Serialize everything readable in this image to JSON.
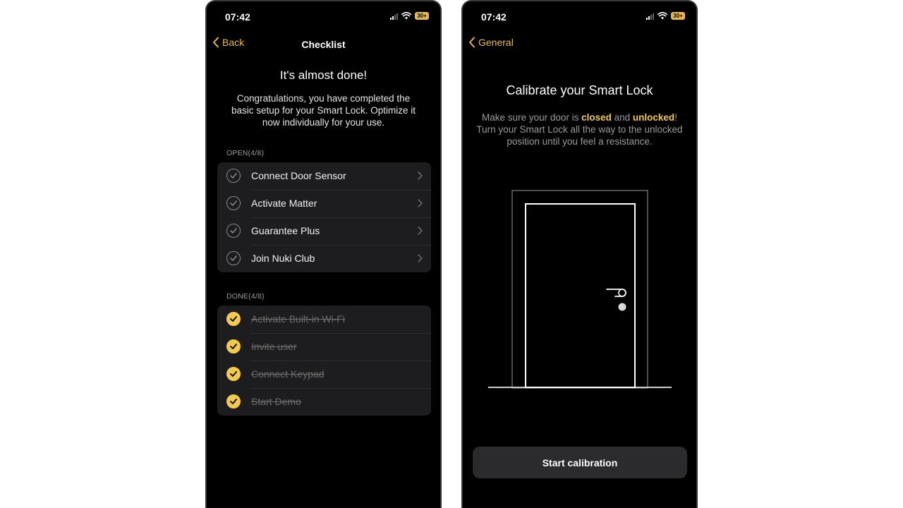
{
  "left_screen": {
    "status": {
      "time": "07:42",
      "battery": "30+"
    },
    "nav": {
      "back_label": "Back",
      "title": "Checklist"
    },
    "heading": "It's almost done!",
    "intro": "Congratulations, you have completed the basic setup for your Smart Lock. Optimize it now individually for your use.",
    "open_section": {
      "label": "OPEN(4/8)",
      "items": [
        {
          "label": "Connect Door Sensor"
        },
        {
          "label": "Activate Matter"
        },
        {
          "label": "Guarantee Plus"
        },
        {
          "label": "Join Nuki Club"
        }
      ]
    },
    "done_section": {
      "label": "DONE(4/8)",
      "items": [
        {
          "label": "Activate Built-in Wi-Fi"
        },
        {
          "label": "Invite user"
        },
        {
          "label": "Connect Keypad"
        },
        {
          "label": "Start Demo"
        }
      ]
    }
  },
  "right_screen": {
    "status": {
      "time": "07:42",
      "battery": "30+"
    },
    "nav": {
      "back_label": "General"
    },
    "heading": "Calibrate your Smart Lock",
    "instruction": {
      "part1": "Make sure your door is ",
      "closed": "closed",
      "part2": " and ",
      "unlocked": "unlocked",
      "part3": "! Turn your Smart Lock all the way to the unlocked position until you feel a resistance."
    },
    "button_label": "Start calibration"
  },
  "colors": {
    "accent": "#f2c94c",
    "background": "#000000",
    "card": "#1d1d1f"
  }
}
